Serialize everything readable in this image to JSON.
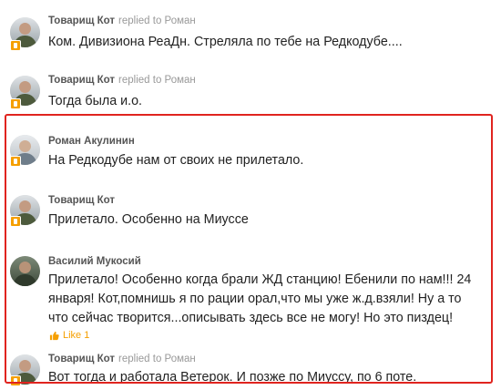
{
  "comments": [
    {
      "author": "Товарищ Кот",
      "replied": "replied to Роман",
      "text": "Ком. Дивизиона РеаДн. Стреляла по тебе на Редкодубе...."
    },
    {
      "author": "Товарищ Кот",
      "replied": "replied to Роман",
      "text": "Тогда была и.о."
    },
    {
      "author": "Роман Акулинин",
      "replied": "",
      "text": "На Редкодубе нам от своих не прилетало."
    },
    {
      "author": "Товарищ Кот",
      "replied": "",
      "text": "Прилетало. Особенно на Миуссе"
    },
    {
      "author": "Василий Мукосий",
      "replied": "",
      "text": "Прилетало! Особенно когда брали ЖД станцию! Ебенили по нам!!! 24 января! Кот,помнишь я по рации орал,что мы уже ж.д.взяли! Ну а то что сейчас творится...описывать здесь все не могу! Но это пиздец!",
      "like": "Like 1"
    },
    {
      "author": "Товарищ Кот",
      "replied": "replied to Роман",
      "text": "Вот тогда и работала Ветерок. И позже по Миуссу,  по 6 поте."
    }
  ],
  "colors": {
    "highlight_border": "#e0241f",
    "like_accent": "#f59f00",
    "author": "#555555",
    "meta": "#999999"
  }
}
